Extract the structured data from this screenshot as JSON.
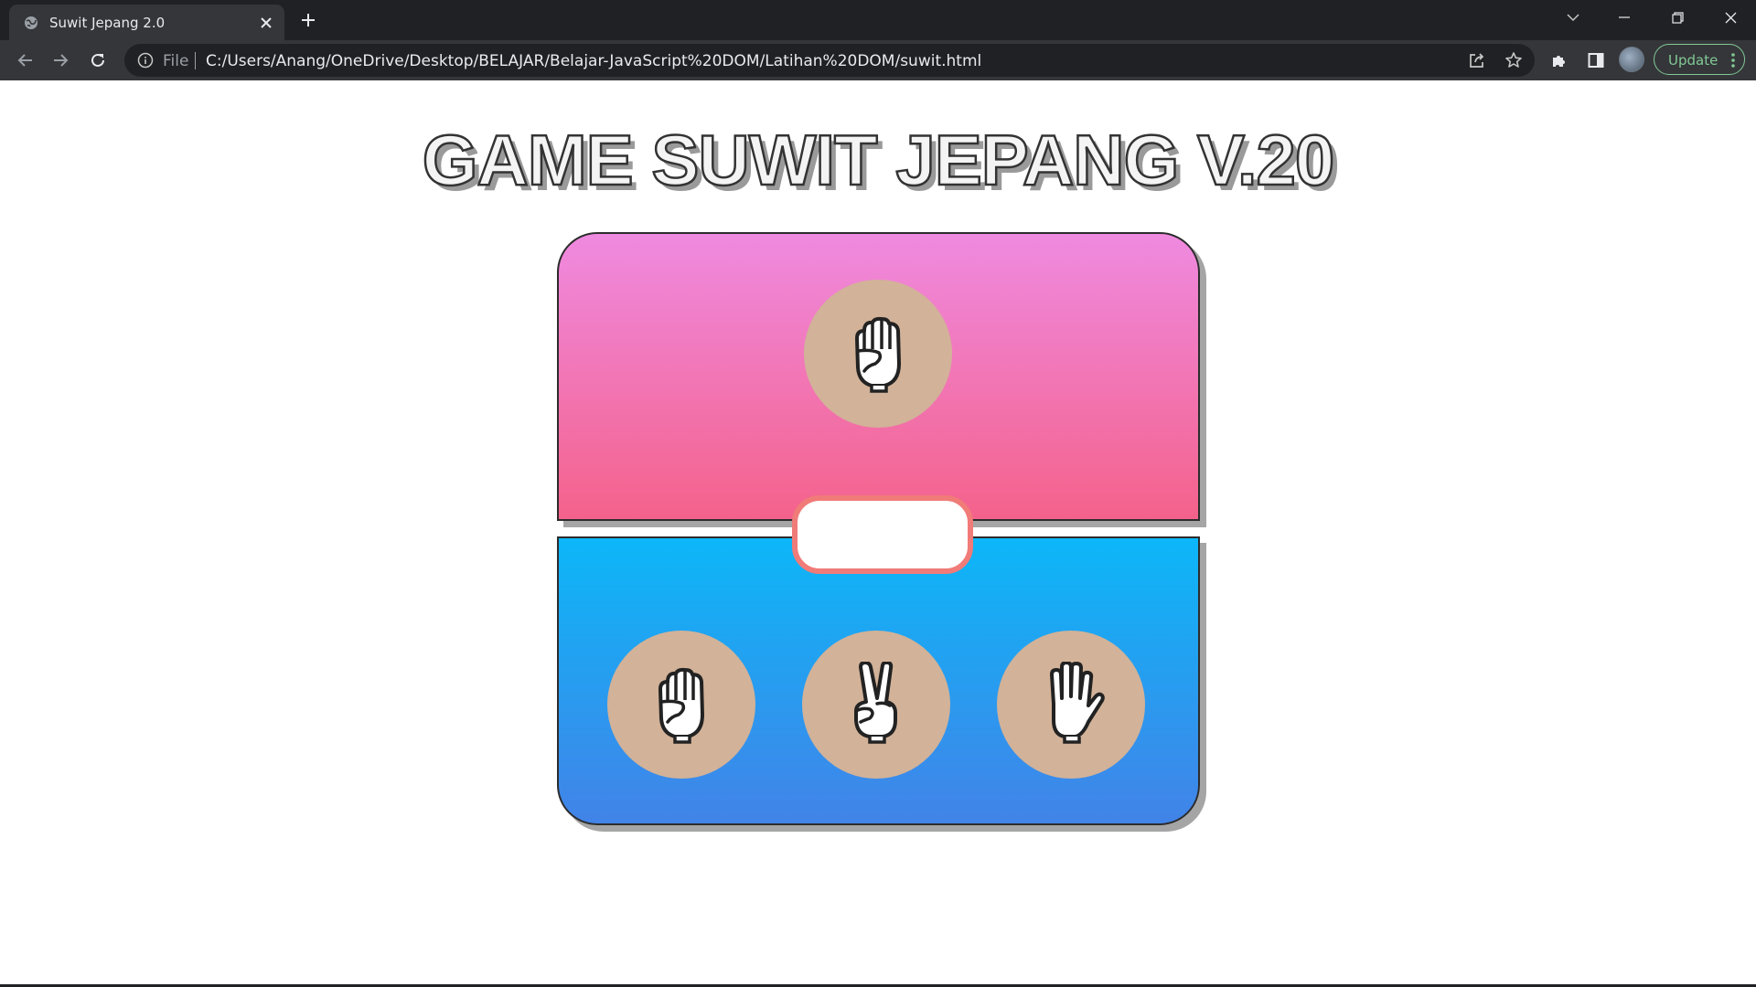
{
  "browser": {
    "tab_title": "Suwit Jepang 2.0",
    "address": {
      "scheme_label": "File",
      "url": "C:/Users/Anang/OneDrive/Desktop/BELAJAR/Belajar-JavaScript%20DOM/Latihan%20DOM/suwit.html"
    },
    "update_label": "Update",
    "icons": {
      "favicon": "globe-icon",
      "tab_close": "close-icon",
      "new_tab": "plus-icon",
      "back": "arrow-left-icon",
      "forward": "arrow-right-icon",
      "reload": "reload-icon",
      "share": "share-icon",
      "bookmark": "star-icon",
      "extensions": "puzzle-icon",
      "side_panel": "side-panel-icon",
      "menu": "kebab-icon"
    },
    "colors": {
      "tabbar": "#202124",
      "toolbar": "#35363a",
      "update_accent": "#81c995"
    }
  },
  "game": {
    "title": "GAME SUWIT JEPANG V.20",
    "result_text": "",
    "computer": {
      "choice": "rock",
      "icon": "fist-hand-icon"
    },
    "player_options": [
      {
        "name": "rock",
        "icon": "fist-hand-icon"
      },
      {
        "name": "scissors",
        "icon": "peace-hand-icon"
      },
      {
        "name": "paper",
        "icon": "open-hand-icon"
      }
    ],
    "colors": {
      "computer_panel_top": "#ef8ae0",
      "computer_panel_bottom": "#f4628b",
      "player_panel_top": "#0cb7f8",
      "player_panel_bottom": "#4283e8",
      "hand_circle": "#d2b298",
      "info_border": "#f07b78"
    }
  }
}
